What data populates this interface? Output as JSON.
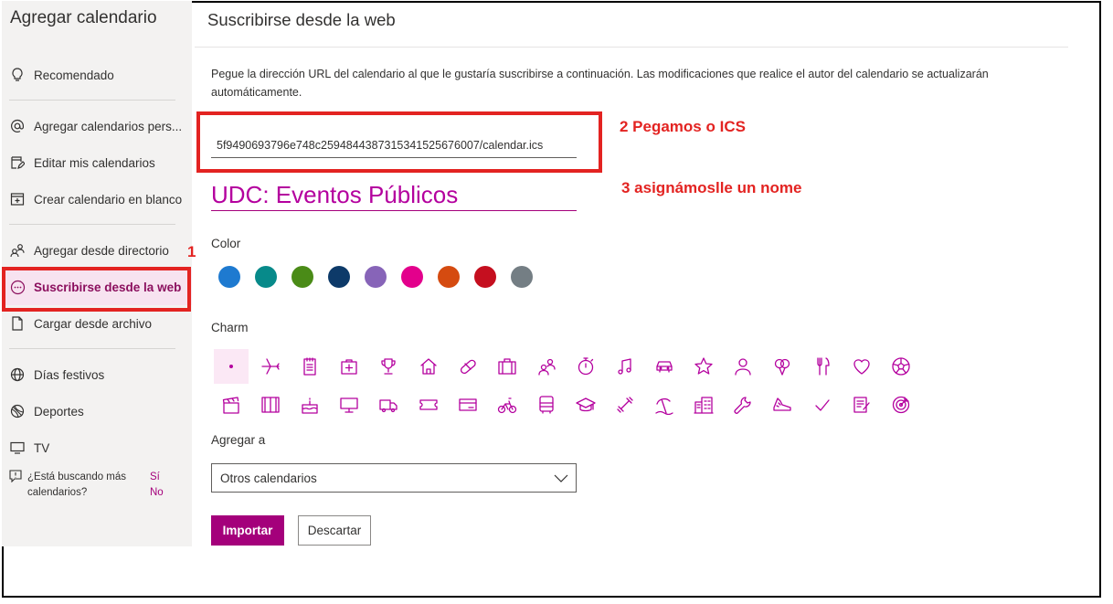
{
  "sidebar": {
    "title": "Agregar calendario",
    "items": [
      {
        "label": "Recomendado",
        "icon": "lightbulb-icon"
      },
      {
        "label": "Agregar calendarios pers...",
        "icon": "at-icon"
      },
      {
        "label": "Editar mis calendarios",
        "icon": "edit-calendar-icon"
      },
      {
        "label": "Crear calendario en blanco",
        "icon": "add-calendar-icon"
      },
      {
        "label": "Agregar desde directorio",
        "icon": "people-icon"
      },
      {
        "label": "Suscribirse desde la web",
        "icon": "web-subscribe-icon"
      },
      {
        "label": "Cargar desde archivo",
        "icon": "file-icon"
      },
      {
        "label": "Días festivos",
        "icon": "globe-icon"
      },
      {
        "label": "Deportes",
        "icon": "sports-ball-icon"
      },
      {
        "label": "TV",
        "icon": "tv-icon"
      }
    ],
    "help_text": "¿Está buscando más calendarios?",
    "help_yes": "Sí",
    "help_no": "No"
  },
  "main": {
    "title": "Suscribirse desde la web",
    "description": "Pegue la dirección URL del calendario al que le gustaría suscribirse a continuación. Las modificaciones que realice el autor del calendario se actualizarán automáticamente.",
    "url_value": "5f9490693796e748c2594844387315341525676007/calendar.ics",
    "name_value": "UDC: Eventos Públicos",
    "color_label": "Color",
    "colors": [
      "#1e7ad0",
      "#078a8a",
      "#4a8b17",
      "#0d3a69",
      "#8764b8",
      "#e3008c",
      "#d54b10",
      "#c50f1f",
      "#747e84"
    ],
    "charm_label": "Charm",
    "charms_row1": [
      "dot-icon",
      "airplane-icon",
      "notepad-icon",
      "first-aid-icon",
      "trophy-icon",
      "home-icon",
      "pill-icon",
      "briefcase-icon",
      "people-icon",
      "stopwatch-icon",
      "music-note-icon",
      "car-icon",
      "star-icon",
      "person-icon",
      "balloons-icon",
      "cutlery-icon",
      "heart-icon",
      "soccer-ball-icon"
    ],
    "charms_row2": [
      "clapperboard-icon",
      "book-icon",
      "cake-icon",
      "monitor-icon",
      "truck-icon",
      "ticket-icon",
      "credit-card-icon",
      "cyclist-icon",
      "bus-icon",
      "graduation-cap-icon",
      "dumbbell-icon",
      "beach-icon",
      "buildings-icon",
      "wrench-icon",
      "sneaker-icon",
      "checkmark-icon",
      "clipboard-icon",
      "target-icon"
    ],
    "add_to_label": "Agregar a",
    "add_to_value": "Otros calendarios",
    "import_label": "Importar",
    "discard_label": "Descartar"
  },
  "annotations": {
    "step1": "1",
    "step2": "2 Pegamos o ICS",
    "step3": "3 asignámoslle un nome"
  },
  "accent_color": "#a4007b"
}
